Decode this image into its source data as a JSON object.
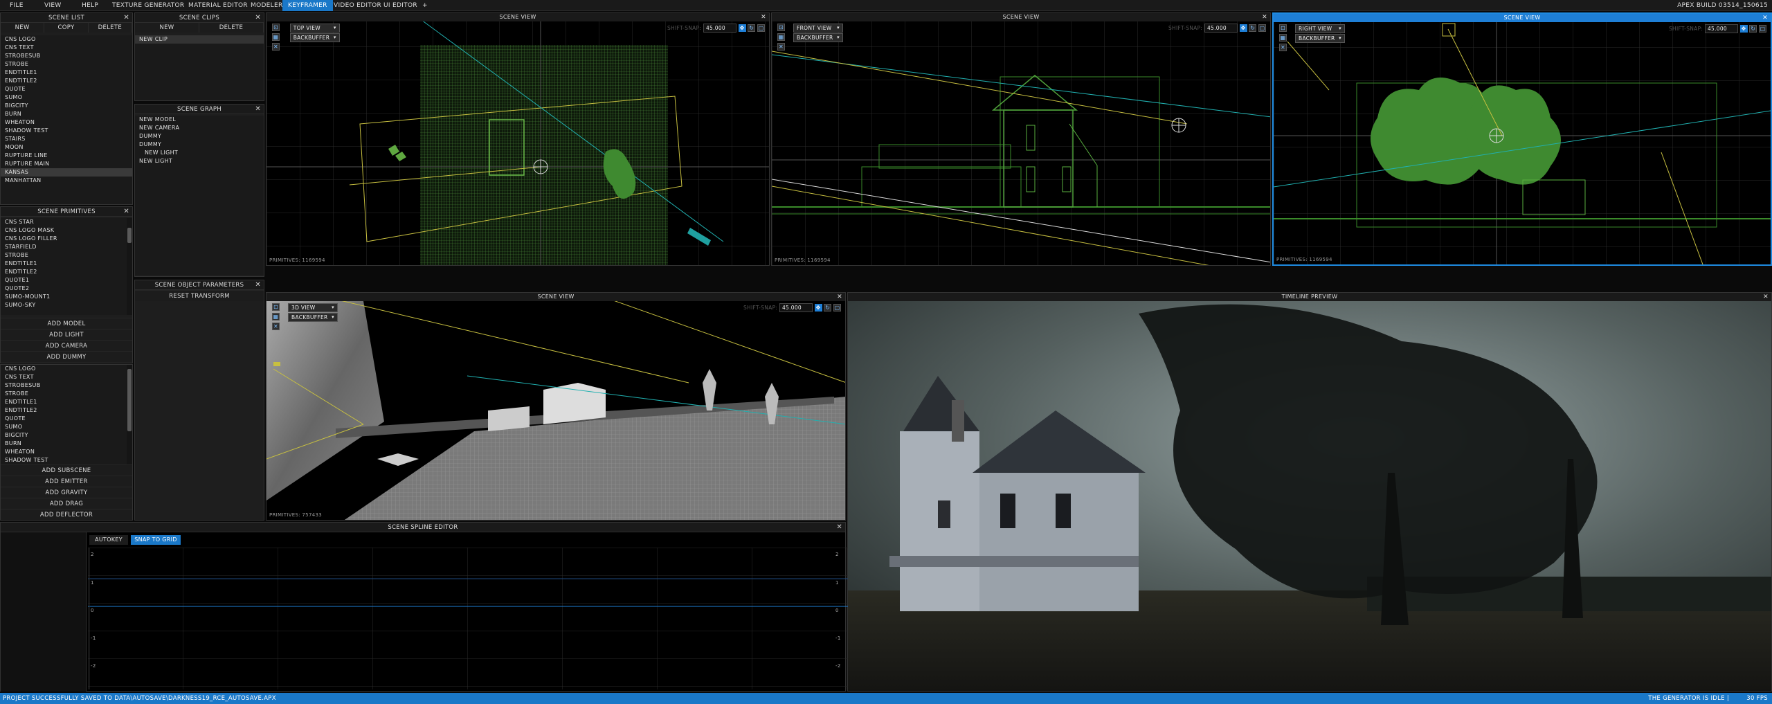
{
  "menu": {
    "items": [
      "FILE",
      "VIEW",
      "HELP",
      "TEXTURE GENERATOR",
      "MATERIAL EDITOR",
      "MODELER",
      "KEYFRAMER",
      "VIDEO EDITOR",
      "UI EDITOR",
      "+"
    ],
    "active": "KEYFRAMER",
    "build": "APEX BUILD 03514_150615"
  },
  "scene_list": {
    "title": "SCENE LIST",
    "buttons": [
      "NEW",
      "COPY",
      "DELETE"
    ],
    "items": [
      "CNS LOGO",
      "CNS TEXT",
      "STROBESUB",
      "STROBE",
      "ENDTITLE1",
      "ENDTITLE2",
      "QUOTE",
      "SUMO",
      "BIGCITY",
      "BURN",
      "WHEATON",
      "SHADOW TEST",
      "STAIRS",
      "MOON",
      "RUPTURE LINE",
      "RUPTURE MAIN",
      "KANSAS",
      "MANHATTAN"
    ],
    "selected": "KANSAS"
  },
  "scene_clips": {
    "title": "SCENE CLIPS",
    "buttons": [
      "NEW",
      "DELETE"
    ],
    "items": [
      "NEW CLIP"
    ]
  },
  "scene_graph": {
    "title": "SCENE GRAPH",
    "items": [
      "NEW MODEL",
      "NEW CAMERA",
      "DUMMY",
      "DUMMY",
      "  NEW LIGHT",
      "NEW LIGHT"
    ]
  },
  "scene_primitives": {
    "title": "SCENE PRIMITIVES",
    "items": [
      "CNS STAR",
      "CNS LOGO MASK",
      "CNS LOGO FILLER",
      "STARFIELD",
      "STROBE",
      "ENDTITLE1",
      "ENDTITLE2",
      "QUOTE1",
      "QUOTE2",
      "SUMO-MOUNT1",
      "SUMO-SKY"
    ],
    "buttons": [
      "ADD MODEL",
      "ADD LIGHT",
      "ADD CAMERA",
      "ADD DUMMY"
    ]
  },
  "subscenes": {
    "items": [
      "CNS LOGO",
      "CNS TEXT",
      "STROBESUB",
      "STROBE",
      "ENDTITLE1",
      "ENDTITLE2",
      "QUOTE",
      "SUMO",
      "BIGCITY",
      "BURN",
      "WHEATON",
      "SHADOW TEST"
    ],
    "buttons": [
      "ADD SUBSCENE",
      "ADD EMITTER",
      "ADD GRAVITY",
      "ADD DRAG",
      "ADD DEFLECTOR"
    ]
  },
  "object_params": {
    "title": "SCENE OBJECT PARAMETERS",
    "reset": "RESET TRANSFORM"
  },
  "views": [
    {
      "title": "SCENE VIEW",
      "mode": "TOP VIEW",
      "buffer": "BACKBUFFER",
      "shift": "SHIFT-SNAP:",
      "value": "45.000",
      "primitives": "PRIMITIVES: 1169594"
    },
    {
      "title": "SCENE VIEW",
      "mode": "FRONT VIEW",
      "buffer": "BACKBUFFER",
      "shift": "SHIFT-SNAP:",
      "value": "45.000",
      "primitives": "PRIMITIVES: 1169594"
    },
    {
      "title": "SCENE VIEW",
      "mode": "RIGHT VIEW",
      "buffer": "BACKBUFFER",
      "shift": "SHIFT-SNAP:",
      "value": "45.000",
      "primitives": "PRIMITIVES: 1169594"
    },
    {
      "title": "SCENE VIEW",
      "mode": "3D VIEW",
      "buffer": "BACKBUFFER",
      "shift": "SHIFT-SNAP:",
      "value": "45.000",
      "primitives": "PRIMITIVES: 757433"
    }
  ],
  "preview": {
    "title": "TIMELINE PREVIEW"
  },
  "spline": {
    "title": "SCENE SPLINE EDITOR",
    "autokey": "AUTOKEY",
    "snap": "SNAP TO GRID",
    "yticks": [
      "2",
      "1",
      "0",
      "-1",
      "-2"
    ]
  },
  "status": {
    "message": "PROJECT SUCCESSFULLY SAVED TO DATA\\AUTOSAVE\\DARKNESS19_RCE_AUTOSAVE.APX",
    "idle": "THE GENERATOR IS IDLE |",
    "fps": "30 FPS"
  },
  "colors": {
    "accent": "#1e7fd6",
    "wire": "#3a8a2a",
    "yellow": "#c8c040",
    "cyan": "#20b0b0"
  }
}
